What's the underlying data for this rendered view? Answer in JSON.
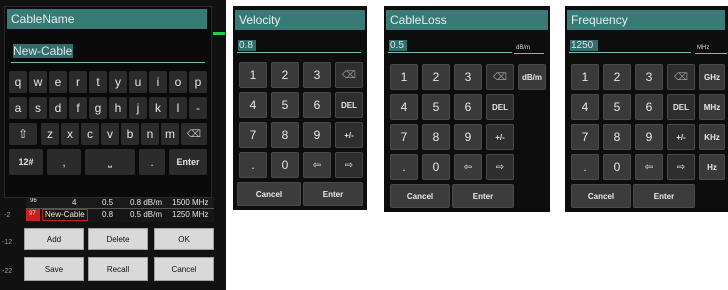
{
  "cable_name_dialog": {
    "title": "CableName",
    "input_value": "New-Cable",
    "keyboard_rows": [
      [
        "q",
        "w",
        "e",
        "r",
        "t",
        "y",
        "u",
        "i",
        "o",
        "p"
      ],
      [
        "a",
        "s",
        "d",
        "f",
        "g",
        "h",
        "j",
        "k",
        "l",
        "-"
      ],
      [
        "z",
        "x",
        "c",
        "v",
        "b",
        "n",
        "m"
      ]
    ],
    "shift_glyph": "⇧",
    "backspace_glyph": "⌫",
    "mode_label": "12#",
    "comma_label": ",",
    "space_glyph": "⎵",
    "period_label": ".",
    "enter_label": "Enter",
    "background_table": {
      "row_96": [
        "96",
        "4",
        "0.5",
        "0.8 dB/m",
        "1500 MHz"
      ],
      "row_97": [
        "97",
        "New-Cable",
        "0.8",
        "0.5 dB/m",
        "1250 MHz"
      ]
    },
    "buttons": {
      "add": "Add",
      "delete": "Delete",
      "ok": "OK",
      "save": "Save",
      "recall": "Recall",
      "cancel": "Cancel"
    },
    "side_labels": [
      "-2",
      "-12",
      "-22"
    ]
  },
  "velocity_dialog": {
    "title": "Velocity",
    "input_value": "0.8",
    "keys": [
      [
        "1",
        "2",
        "3",
        "⌫"
      ],
      [
        "4",
        "5",
        "6",
        "DEL"
      ],
      [
        "7",
        "8",
        "9",
        "+/-"
      ],
      [
        ".",
        "0",
        "⇦",
        "⇨"
      ]
    ],
    "cancel": "Cancel",
    "enter": "Enter"
  },
  "cableloss_dialog": {
    "title": "CableLoss",
    "input_value": "0.5",
    "unit": "dB/m",
    "keys": [
      [
        "1",
        "2",
        "3",
        "⌫",
        "dB/m"
      ],
      [
        "4",
        "5",
        "6",
        "DEL"
      ],
      [
        "7",
        "8",
        "9",
        "+/-"
      ],
      [
        ".",
        "0",
        "⇦",
        "⇨"
      ]
    ],
    "cancel": "Cancel",
    "enter": "Enter"
  },
  "frequency_dialog": {
    "title": "Frequency",
    "input_value": "1250",
    "unit": "MHz",
    "keys": [
      [
        "1",
        "2",
        "3",
        "⌫",
        "GHz"
      ],
      [
        "4",
        "5",
        "6",
        "DEL",
        "MHz"
      ],
      [
        "7",
        "8",
        "9",
        "+/-",
        "KHz"
      ],
      [
        ".",
        "0",
        "⇦",
        "⇨",
        "Hz"
      ]
    ],
    "cancel": "Cancel",
    "enter": "Enter"
  },
  "colors": {
    "title_bg": "#377a76",
    "panel_bg": "#0d0d0d",
    "key_bg": "#3a3a3a",
    "highlight_red": "#cc1e1e"
  }
}
